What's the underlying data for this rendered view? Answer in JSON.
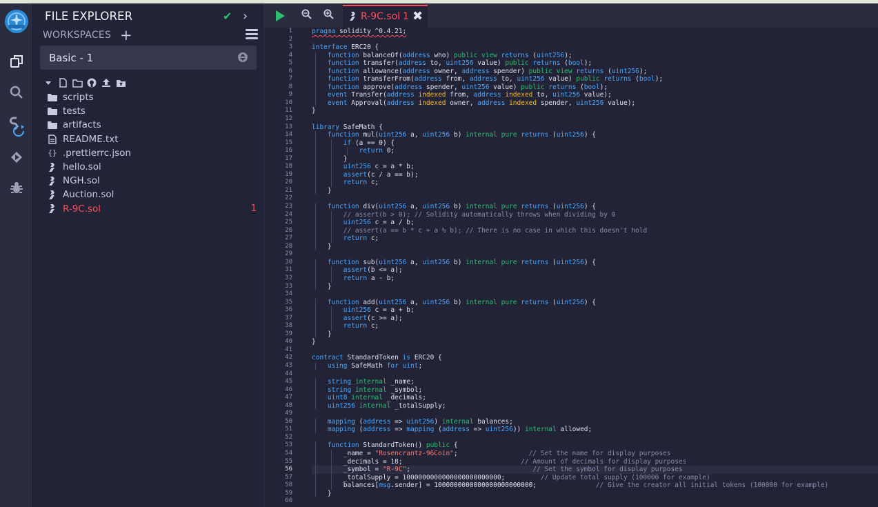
{
  "explorer": {
    "title": "FILE EXPLORER",
    "workspaces_label": "WORKSPACES",
    "workspace_selected": "Basic - 1",
    "files": [
      {
        "name": "scripts",
        "kind": "folder"
      },
      {
        "name": "tests",
        "kind": "folder"
      },
      {
        "name": "artifacts",
        "kind": "folder"
      },
      {
        "name": "README.txt",
        "kind": "file"
      },
      {
        "name": ".prettierrc.json",
        "kind": "json"
      },
      {
        "name": "hello.sol",
        "kind": "sol"
      },
      {
        "name": "NGH.sol",
        "kind": "sol"
      },
      {
        "name": "Auction.sol",
        "kind": "sol"
      },
      {
        "name": "R-9C.sol",
        "kind": "sol",
        "active": true,
        "badge": "1"
      }
    ]
  },
  "editor": {
    "tab": {
      "name": "R-9C.sol",
      "badge": "1"
    },
    "current_line": 56,
    "lines": [
      "pragma solidity ^0.4.21;",
      "",
      "interface ERC20 {",
      "    function balanceOf(address who) public view returns (uint256);",
      "    function transfer(address to, uint256 value) public returns (bool);",
      "    function allowance(address owner, address spender) public view returns (uint256);",
      "    function transferFrom(address from, address to, uint256 value) public returns (bool);",
      "    function approve(address spender, uint256 value) public returns (bool);",
      "    event Transfer(address indexed from, address indexed to, uint256 value);",
      "    event Approval(address indexed owner, address indexed spender, uint256 value);",
      "}",
      "",
      "library SafeMath {",
      "    function mul(uint256 a, uint256 b) internal pure returns (uint256) {",
      "        if (a == 0) {",
      "            return 0;",
      "        }",
      "        uint256 c = a * b;",
      "        assert(c / a == b);",
      "        return c;",
      "    }",
      "",
      "    function div(uint256 a, uint256 b) internal pure returns (uint256) {",
      "        // assert(b > 0); // Solidity automatically throws when dividing by 0",
      "        uint256 c = a / b;",
      "        // assert(a == b * c + a % b); // There is no case in which this doesn't hold",
      "        return c;",
      "    }",
      "",
      "    function sub(uint256 a, uint256 b) internal pure returns (uint256) {",
      "        assert(b <= a);",
      "        return a - b;",
      "    }",
      "",
      "    function add(uint256 a, uint256 b) internal pure returns (uint256) {",
      "        uint256 c = a + b;",
      "        assert(c >= a);",
      "        return c;",
      "    }",
      "}",
      "",
      "contract StandardToken is ERC20 {",
      "    using SafeMath for uint;",
      "",
      "    string internal _name;",
      "    string internal _symbol;",
      "    uint8 internal _decimals;",
      "    uint256 internal _totalSupply;",
      "",
      "    mapping (address => uint256) internal balances;",
      "    mapping (address => mapping (address => uint256)) internal allowed;",
      "",
      "    function StandardToken() public {",
      "        _name = \"Rosencrantz-96Coin\";                  // Set the name for display purposes",
      "        _decimals = 18;                              // Amount of decimals for display purposes",
      "        _symbol = \"R-9C\";                               // Set the symbol for display purposes",
      "        _totalSupply = 1000000000000000000000000;         // Update total supply (100000 for example)",
      "        balances[msg.sender] = 1000000000000000000000000;               // Give the creator all initial tokens (100000 for example)",
      "    }",
      ""
    ]
  },
  "colors": {
    "background": "#222336",
    "panel": "#2a2c3f",
    "accent_red": "#ff4d5e",
    "accent_green": "#2fbf71",
    "keyword_blue": "#4aa8ff",
    "indexed_yellow": "#f5b828"
  },
  "icons": {
    "rail": [
      "remix-logo-icon",
      "file-explorer-icon",
      "search-icon",
      "compile-icon",
      "deploy-icon",
      "debugger-icon"
    ],
    "file_toolbar": [
      "collapse-icon",
      "new-file-icon",
      "new-folder-icon",
      "github-icon",
      "upload-icon",
      "publish-icon"
    ]
  }
}
